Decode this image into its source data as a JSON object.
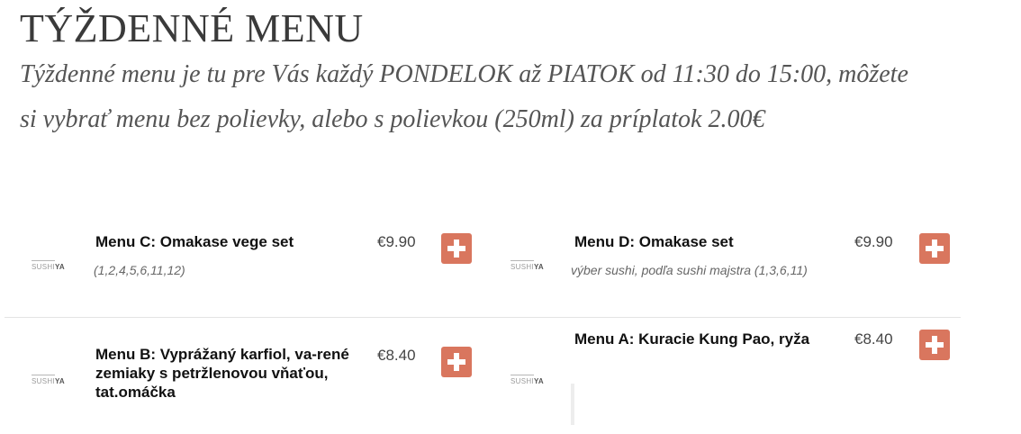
{
  "page": {
    "title": "TÝŽDENNÉ MENU",
    "intro": "Týždenné menu je tu pre Vás každý PONDELOK až PIATOK od 11:30 do 15:00, môžete si vybrať  menu bez polievky, alebo s polievkou (250ml) za príplatok 2.00€"
  },
  "logo": {
    "part1": "SUSHI",
    "part2": "YA"
  },
  "menu_items": [
    {
      "name": "Menu C: Omakase vege set",
      "price": "€9.90",
      "description": "(1,2,4,5,6,11,12)"
    },
    {
      "name": "Menu D: Omakase set",
      "price": "€9.90",
      "description": "výber sushi, podľa sushi majstra (1,3,6,11)"
    },
    {
      "name": "Menu B: Vyprážaný karfiol, va-rené zemiaky s petržlenovou vňaťou, tat.omáčka",
      "price": "€8.40",
      "description": ""
    },
    {
      "name": "Menu A: Kuracie Kung Pao, ryža",
      "price": "€8.40",
      "description": ""
    }
  ],
  "icons": {
    "add": "plus-icon",
    "add_color": "#d9765e"
  }
}
